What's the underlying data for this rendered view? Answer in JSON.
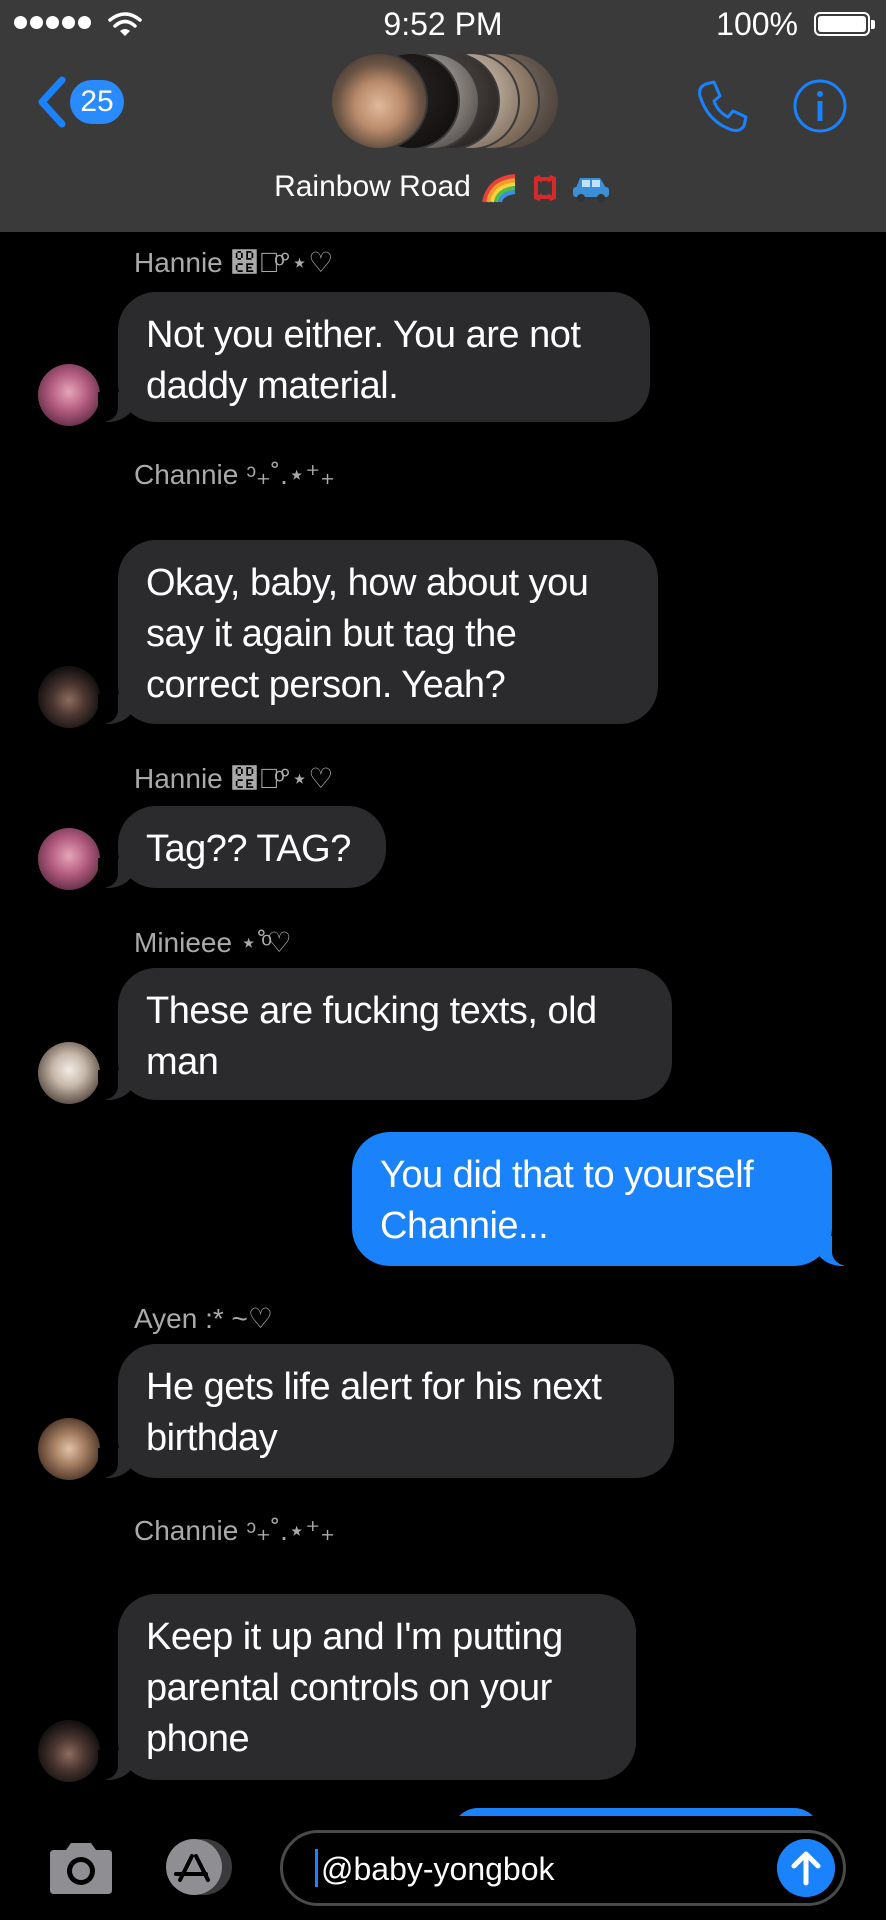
{
  "status_bar": {
    "time": "9:52 PM",
    "battery": "100%",
    "signal_icon": "signal-dots-icon",
    "wifi_icon": "wifi-icon"
  },
  "header": {
    "back_count": "25",
    "group_name": "Rainbow Road",
    "title_emojis": [
      "rainbow-emoji",
      "anger-symbol-emoji",
      "car-emoji"
    ],
    "call_icon": "phone-icon",
    "info_icon": "info-icon",
    "accent_color": "#1a82fb"
  },
  "messages": [
    {
      "sender": "Hannie ෎⋆ͦ°⋆♡",
      "text": "Not you either. You are not daddy material.",
      "direction": "incoming",
      "avatar": "hannie"
    },
    {
      "sender": "Channie ᵓ₊˚.⋆⁺₊",
      "text": "Okay, baby, how about you say it again but tag the correct person. Yeah?",
      "direction": "incoming",
      "avatar": "channie"
    },
    {
      "sender": "Hannie ෎⋆ͦ°⋆♡",
      "text": "Tag?? TAG?",
      "direction": "incoming",
      "avatar": "hannie"
    },
    {
      "sender": "Minieee ⋆˚ͦ♡",
      "text": "These are fucking texts, old man",
      "direction": "incoming",
      "avatar": "minieee"
    },
    {
      "sender": "",
      "text": "You did that to yourself Channie...",
      "direction": "outgoing"
    },
    {
      "sender": "Ayen :* ~♡",
      "text": "He gets life alert for his next birthday",
      "direction": "incoming",
      "avatar": "ayen"
    },
    {
      "sender": "Channie ᵓ₊˚.⋆⁺₊",
      "text": "Keep it up and I'm putting parental controls on your phone",
      "direction": "incoming",
      "avatar": "channie"
    }
  ],
  "input": {
    "value": "@baby-yongbok",
    "camera_icon": "camera-icon",
    "apps_icon": "app-store-icon",
    "send_icon": "send-arrow-icon"
  }
}
